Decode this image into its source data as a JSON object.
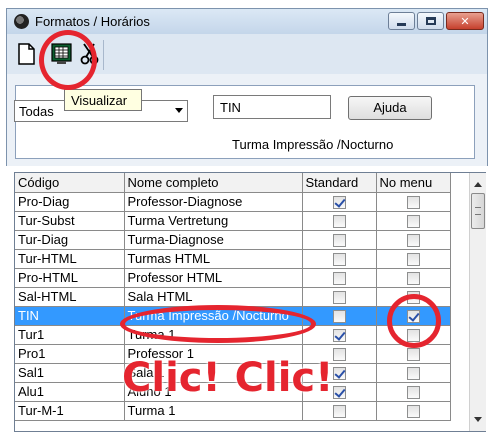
{
  "window": {
    "title": "Formatos / Horários",
    "icon": "clock-icon"
  },
  "toolbar": {
    "tools": [
      {
        "name": "new-document-icon"
      },
      {
        "name": "view-grid-icon",
        "tooltip": "Visualizar"
      },
      {
        "name": "scissors-icon"
      }
    ]
  },
  "filter": {
    "combo_value": "Todas",
    "code_value": "TIN",
    "help_label": "Ajuda",
    "description": "Turma Impressão /Nocturno"
  },
  "grid": {
    "columns": [
      "Código",
      "Nome completo",
      "Standard",
      "No menu"
    ],
    "rows": [
      {
        "code": "Pro-Diag",
        "name": "Professor-Diagnose",
        "standard": true,
        "menu": false
      },
      {
        "code": "Tur-Subst",
        "name": "Turma Vertretung",
        "standard": false,
        "menu": false
      },
      {
        "code": "Tur-Diag",
        "name": "Turma-Diagnose",
        "standard": false,
        "menu": false
      },
      {
        "code": "Tur-HTML",
        "name": "Turmas HTML",
        "standard": false,
        "menu": false
      },
      {
        "code": "Pro-HTML",
        "name": "Professor HTML",
        "standard": false,
        "menu": false
      },
      {
        "code": "Sal-HTML",
        "name": "Sala HTML",
        "standard": false,
        "menu": false
      },
      {
        "code": "TIN",
        "name": "Turma Impressão /Nocturno",
        "standard": false,
        "menu": true,
        "selected": true
      },
      {
        "code": "Tur1",
        "name": "Turma 1",
        "standard": true,
        "menu": false
      },
      {
        "code": "Pro1",
        "name": "Professor 1",
        "standard": false,
        "menu": false
      },
      {
        "code": "Sal1",
        "name": "Sala 1",
        "standard": true,
        "menu": false
      },
      {
        "code": "Alu1",
        "name": "Aluno 1",
        "standard": true,
        "menu": false
      },
      {
        "code": "Tur-M-1",
        "name": "Turma 1",
        "standard": false,
        "menu": false
      }
    ]
  },
  "annotation": {
    "text": "Clic! Clic!",
    "color": "#e5252f"
  },
  "colors": {
    "selection": "#3399ff",
    "titlebar": "#c4d6ea"
  }
}
